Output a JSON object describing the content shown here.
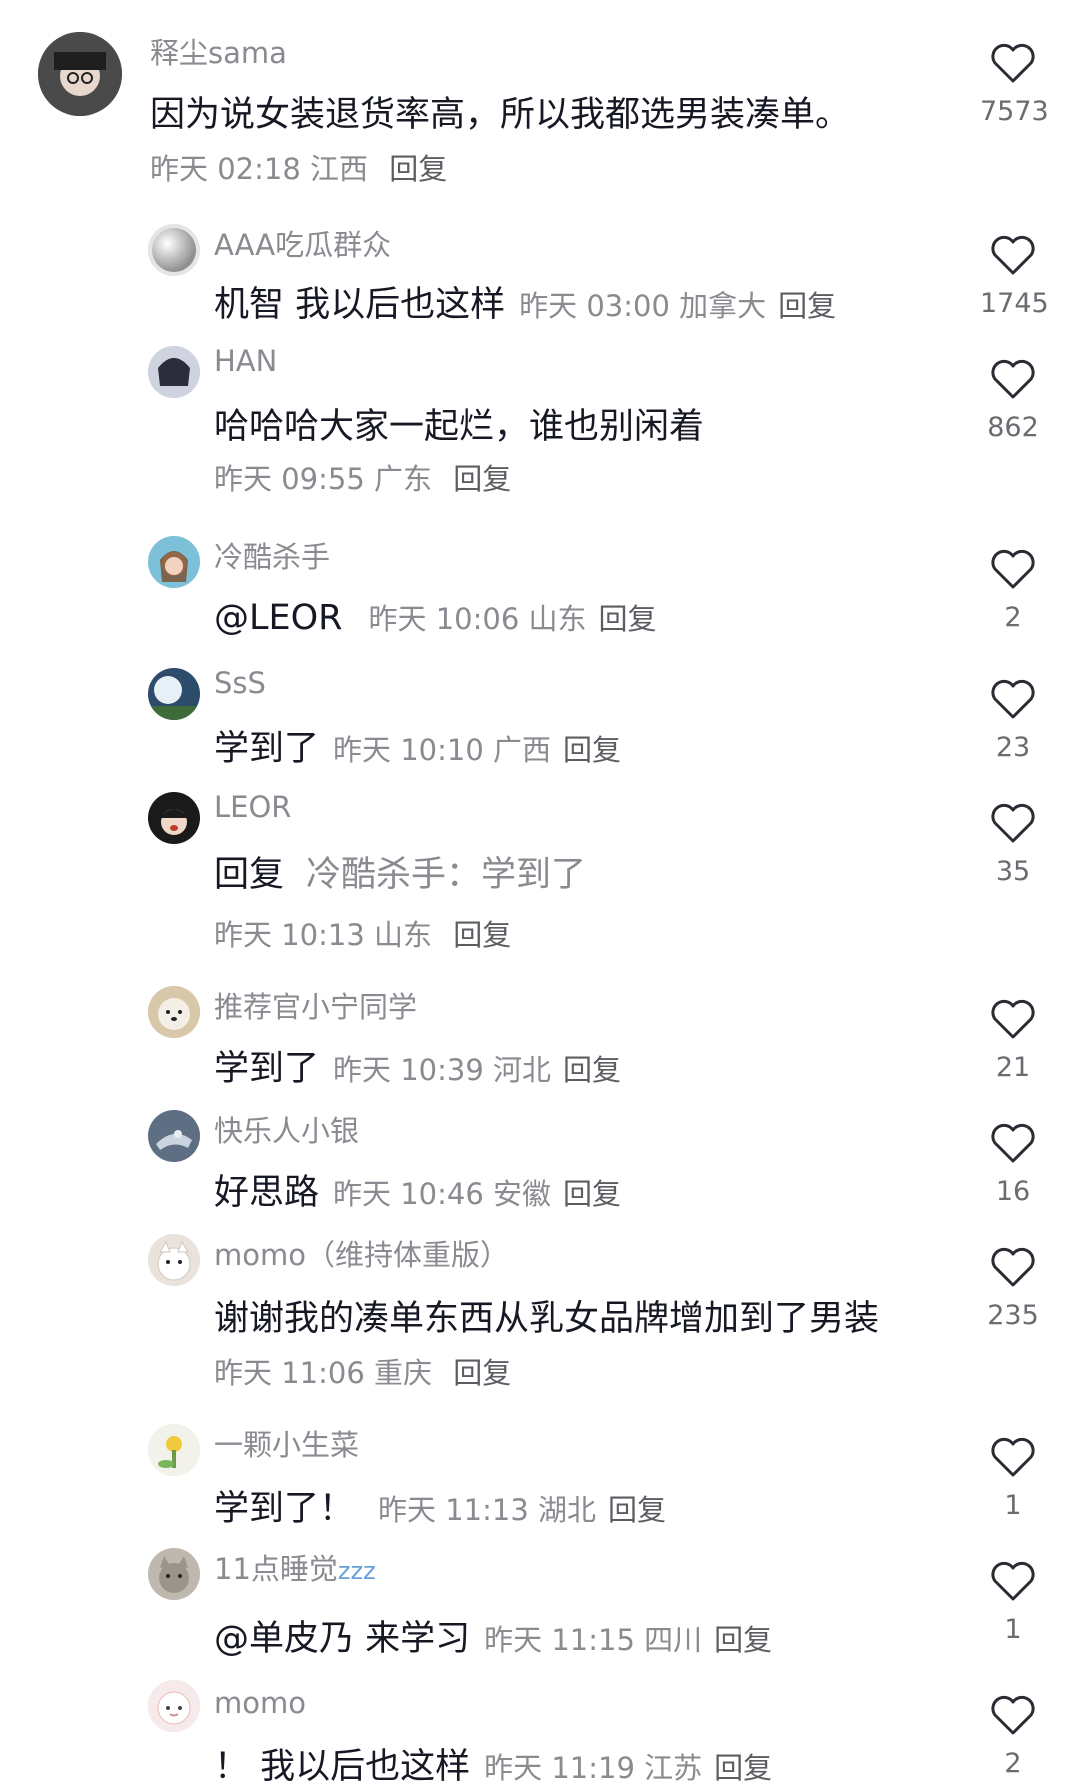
{
  "comments": [
    {
      "user": "释尘sama",
      "text": "因为说女装退货率高，所以我都选男装凑单。",
      "time": "昨天 02:18",
      "location": "江西",
      "reply": "回复",
      "likes": "7573"
    },
    {
      "user": "AAA吃瓜群众",
      "text": "机智 我以后也这样",
      "time": "昨天 03:00",
      "location": "加拿大",
      "reply": "回复",
      "likes": "1745"
    },
    {
      "user": "HAN",
      "text": "哈哈哈大家一起烂，谁也别闲着",
      "time": "昨天 09:55",
      "location": "广东",
      "reply": "回复",
      "likes": "862"
    },
    {
      "user": "冷酷杀手",
      "text": "@LEOR",
      "time": "昨天 10:06",
      "location": "山东",
      "reply": "回复",
      "likes": "2"
    },
    {
      "user": "SsS",
      "text": "学到了",
      "time": "昨天 10:10",
      "location": "广西",
      "reply": "回复",
      "likes": "23"
    },
    {
      "user": "LEOR",
      "reply_word": "回复",
      "quoted": "冷酷杀手：学到了",
      "time": "昨天 10:13",
      "location": "山东",
      "reply": "回复",
      "likes": "35"
    },
    {
      "user": "推荐官小宁同学",
      "text": "学到了",
      "time": "昨天 10:39",
      "location": "河北",
      "reply": "回复",
      "likes": "21"
    },
    {
      "user": "快乐人小银",
      "text": "好思路",
      "time": "昨天 10:46",
      "location": "安徽",
      "reply": "回复",
      "likes": "16"
    },
    {
      "user": "momo（维持体重版）",
      "text": "谢谢我的凑单东西从乳女品牌增加到了男装",
      "time": "昨天 11:06",
      "location": "重庆",
      "reply": "回复",
      "likes": "235"
    },
    {
      "user": "一颗小生菜",
      "text": "学到了！",
      "time": "昨天 11:13",
      "location": "湖北",
      "reply": "回复",
      "likes": "1"
    },
    {
      "user": "11点睡觉",
      "user_suffix": "zzz",
      "text": "@单皮乃 来学习",
      "time": "昨天 11:15",
      "location": "四川",
      "reply": "回复",
      "likes": "1"
    },
    {
      "user": "momo",
      "text": "！ 我以后也这样",
      "time": "昨天 11:19",
      "location": "江苏",
      "reply": "回复",
      "likes": "2"
    }
  ],
  "icons": {
    "like": "heart-outline-icon"
  },
  "colors": {
    "text": "#161823",
    "meta": "#8a8b91",
    "like_icon": "#2b2c33"
  }
}
